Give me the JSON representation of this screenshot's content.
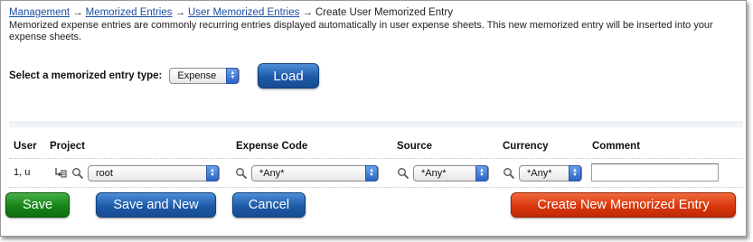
{
  "breadcrumb": {
    "items": [
      "Management",
      "Memorized Entries",
      "User Memorized Entries"
    ],
    "separator": "→",
    "current": "Create User Memorized Entry"
  },
  "description": "Memorized expense entries are commonly recurring entries displayed automatically in user expense sheets. This new memorized entry will be inserted into your expense sheets.",
  "type_select": {
    "label": "Select a memorized entry type:",
    "value": "Expense",
    "load_label": "Load"
  },
  "table": {
    "columns": [
      "User",
      "Project",
      "Expense Code",
      "Source",
      "Currency",
      "Comment"
    ],
    "row": {
      "user": "1, u",
      "project": "root",
      "expense_code": "*Any*",
      "source": "*Any*",
      "currency": "*Any*",
      "comment": ""
    }
  },
  "buttons": {
    "save": "Save",
    "save_and_new": "Save and New",
    "cancel": "Cancel",
    "create_new": "Create New Memorized Entry"
  },
  "colors": {
    "link": "#1a4fa3",
    "button_blue": "#1d5aa8",
    "button_green": "#178417",
    "button_red": "#d9360c"
  },
  "icons": {
    "search": "magnifier-icon",
    "tree": "tree-picker-icon",
    "select_arrows": "up-down-arrows-icon"
  }
}
